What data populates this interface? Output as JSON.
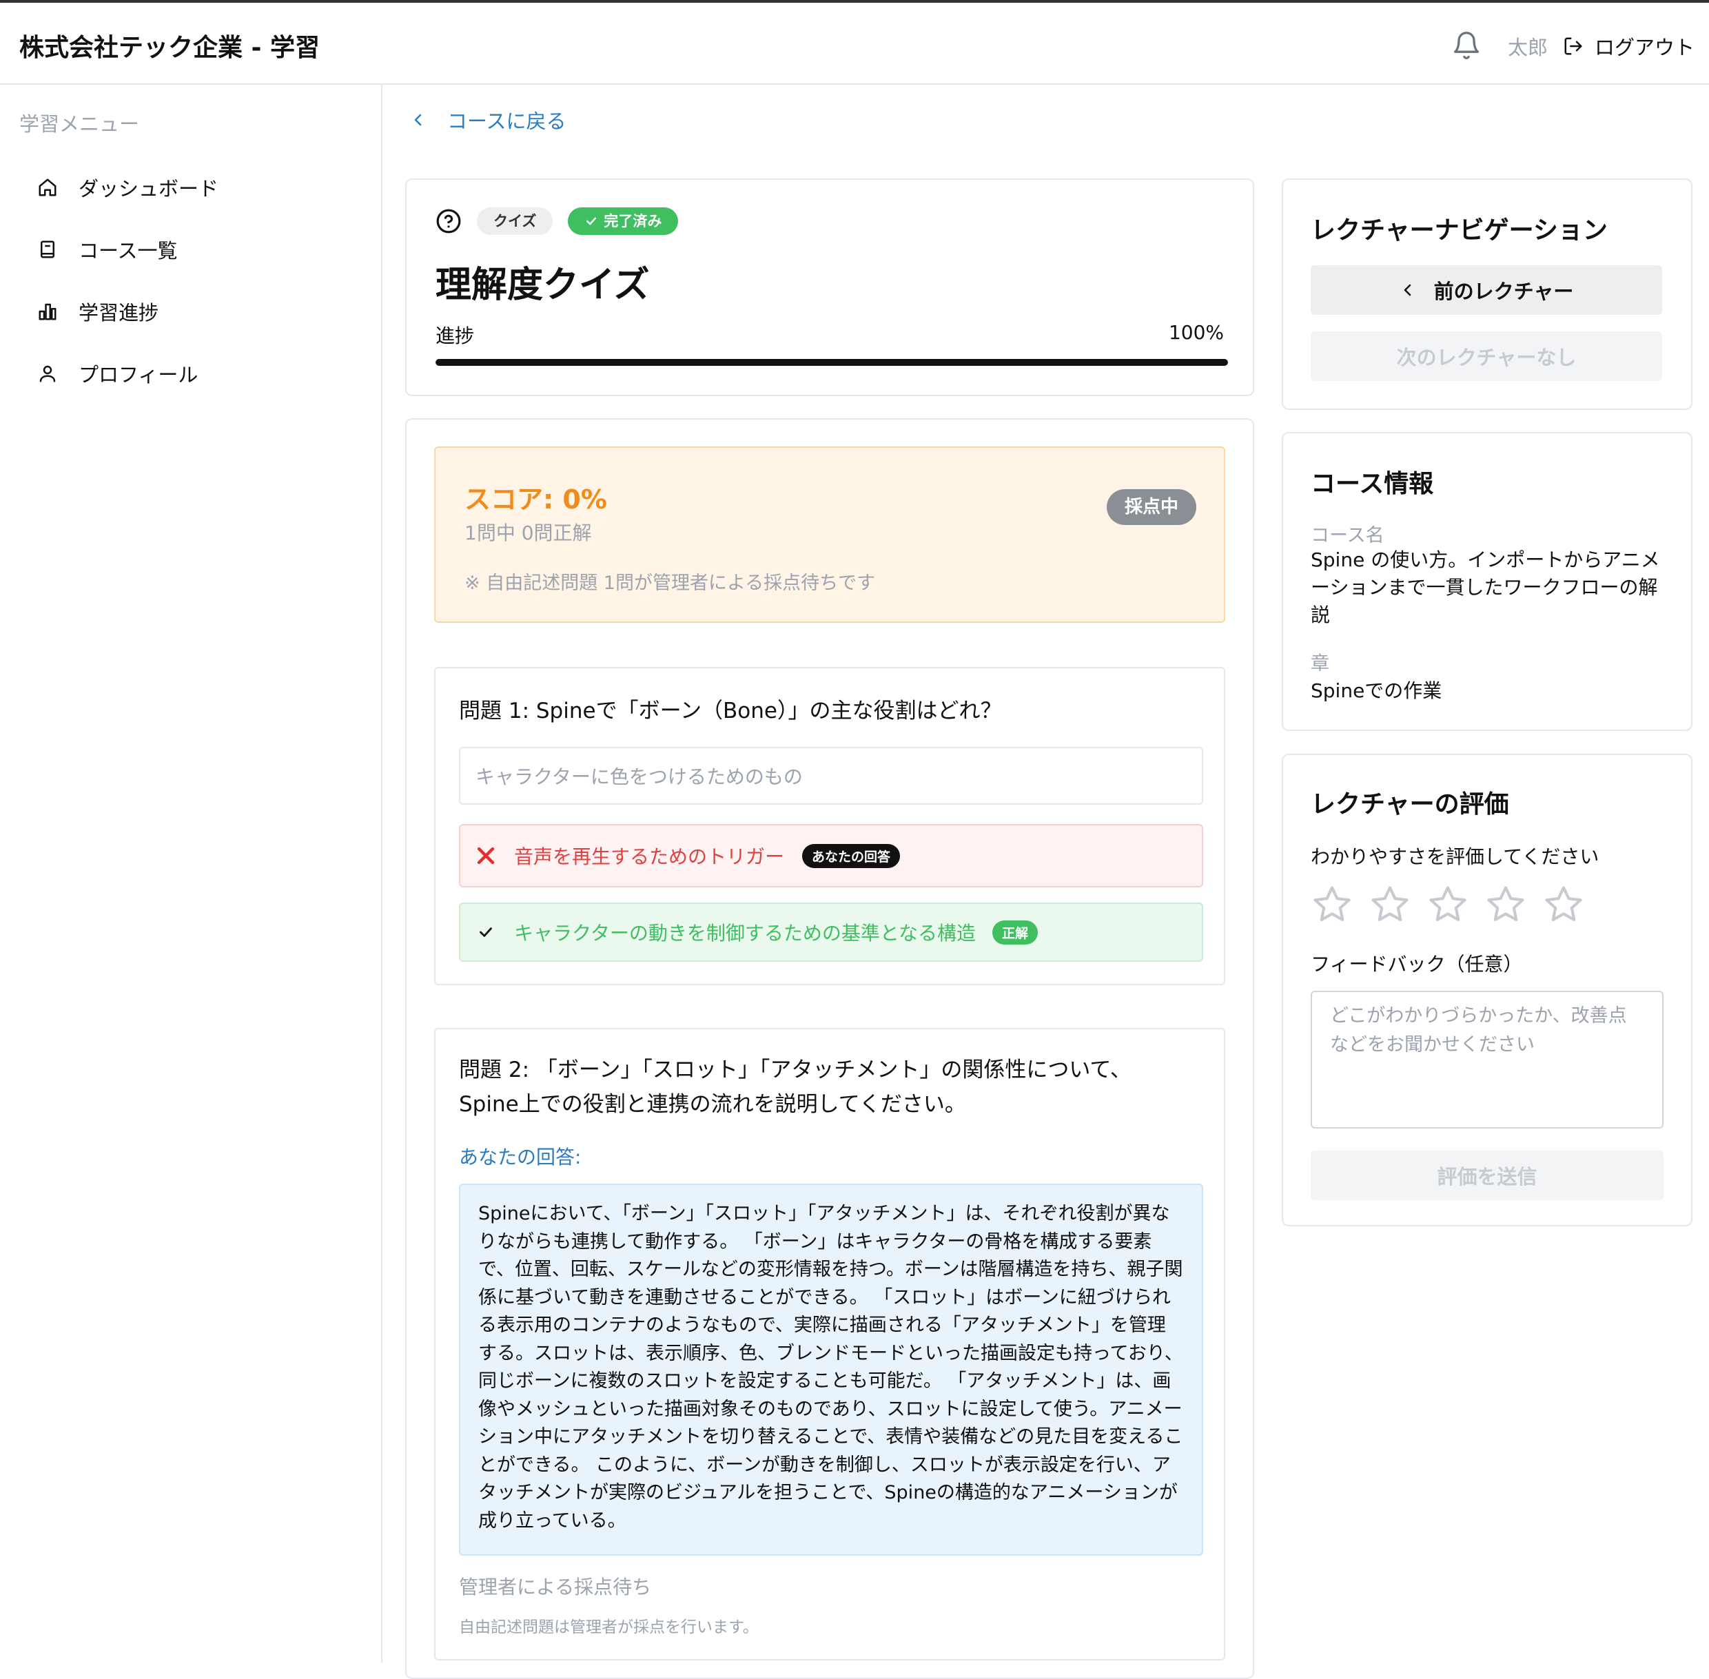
{
  "header": {
    "title": "株式会社テック企業 - 学習",
    "user": "太郎",
    "logout_label": "ログアウト"
  },
  "sidebar": {
    "heading": "学習メニュー",
    "items": [
      {
        "label": "ダッシュボード",
        "icon": "home-icon"
      },
      {
        "label": "コース一覧",
        "icon": "book-icon"
      },
      {
        "label": "学習進捗",
        "icon": "chart-icon"
      },
      {
        "label": "プロフィール",
        "icon": "user-icon"
      }
    ]
  },
  "back_link": "コースに戻る",
  "lecture": {
    "type_badge": "クイズ",
    "status_badge": "完了済み",
    "title": "理解度クイズ",
    "progress_label": "進捗",
    "progress_text": "100%",
    "progress_value": 1.0
  },
  "score": {
    "title": "スコア: 0%",
    "summary": "1問中 0問正解",
    "note": "※ 自由記述問題 1問が管理者による採点待ちです",
    "badge": "採点中"
  },
  "question1": {
    "text": "問題 1: Spineで「ボーン（Bone）」の主な役割はどれ？",
    "options": [
      {
        "text": "キャラクターに色をつけるためのもの",
        "state": "neutral"
      },
      {
        "text": "音声を再生するためのトリガー",
        "state": "wrong",
        "tag": "あなたの回答"
      },
      {
        "text": "キャラクターの動きを制御するための基準となる構造",
        "state": "correct",
        "tag": "正解"
      }
    ]
  },
  "question2": {
    "text_line1": "問題 2: 「ボーン」「スロット」「アタッチメント」の関係性について、",
    "text_line2": "Spine上での役割と連携の流れを説明してください。",
    "answer_label": "あなたの回答:",
    "answer": "Spineにおいて、「ボーン」「スロット」「アタッチメント」は、それぞれ役割が異なりながらも連携して動作する。 「ボーン」はキャラクターの骨格を構成する要素で、位置、回転、スケールなどの変形情報を持つ。ボーンは階層構造を持ち、親子関係に基づいて動きを連動させることができる。 「スロット」はボーンに紐づけられる表示用のコンテナのようなもので、実際に描画される「アタッチメント」を管理する。スロットは、表示順序、色、ブレンドモードといった描画設定も持っており、同じボーンに複数のスロットを設定することも可能だ。 「アタッチメント」は、画像やメッシュといった描画対象そのものであり、スロットに設定して使う。アニメーション中にアタッチメントを切り替えることで、表情や装備などの見た目を変えることができる。 このように、ボーンが動きを制御し、スロットが表示設定を行い、アタッチメントが実際のビジュアルを担うことで、Spineの構造的なアニメーションが成り立っている。",
    "pending_title": "管理者による採点待ち",
    "pending_note": "自由記述問題は管理者が採点を行います。"
  },
  "nav": {
    "title": "レクチャーナビゲーション",
    "prev_label": "前のレクチャー",
    "next_label": "次のレクチャーなし"
  },
  "course_info": {
    "title": "コース情報",
    "course_name_label": "コース名",
    "course_name": "Spine の使い方。インポートからアニメーションまで一貫したワークフローの解説",
    "chapter_label": "章",
    "chapter": "Spineでの作業"
  },
  "rating": {
    "title": "レクチャーの評価",
    "prompt": "わかりやすさを評価してください",
    "stars": 0,
    "max_stars": 5,
    "feedback_label": "フィードバック（任意）",
    "feedback_placeholder": "どこがわかりづらかったか、改善点などをお聞かせください",
    "submit_label": "評価を送信"
  },
  "colors": {
    "accent_blue": "#2b7bc2",
    "success_green": "#3fbf60",
    "error_red": "#e04040",
    "score_orange": "#f08c1e"
  }
}
